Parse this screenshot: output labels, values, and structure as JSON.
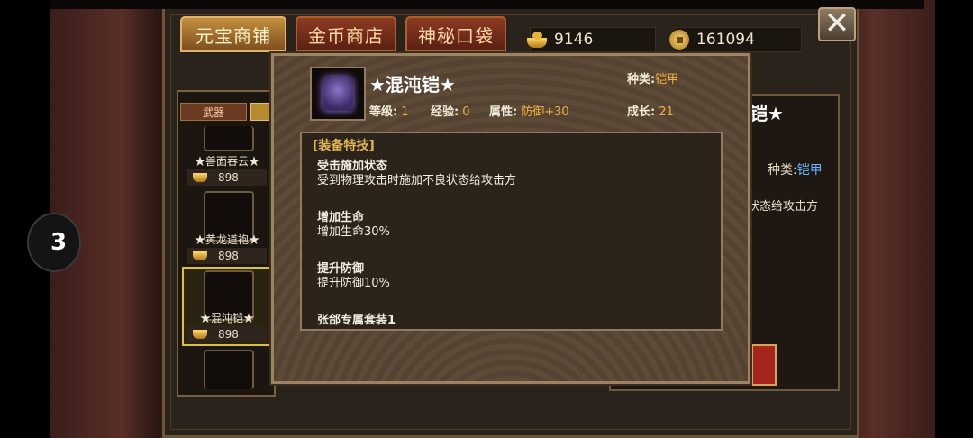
{
  "tabs": [
    {
      "label": "元宝商铺",
      "active": true
    },
    {
      "label": "金币商店",
      "active": false
    },
    {
      "label": "神秘口袋",
      "active": false
    }
  ],
  "currency": {
    "ingot_icon": "gold-ingot-icon",
    "ingot_amount": "9146",
    "coin_icon": "gold-coin-icon",
    "coin_amount": "161094"
  },
  "close_icon": "close-icon",
  "categories": [
    "武器",
    ""
  ],
  "shop_items": [
    {
      "name": "★兽面吞云★",
      "price": "898"
    },
    {
      "name": "★黄龙道袍★",
      "price": "898"
    },
    {
      "name": "★混沌铠★",
      "price": "898",
      "selected": true
    },
    {
      "name": "",
      "price": ""
    }
  ],
  "background_panel": {
    "title_fragment": "铠★",
    "type_label": "种类:",
    "type_value": "铠甲",
    "text_fragment": "状态给攻击方"
  },
  "popup": {
    "item_name": "★混沌铠★",
    "type_label": "种类:",
    "type_value": "铠甲",
    "level_label": "等级:",
    "level_value": "1",
    "exp_label": "经验:",
    "exp_value": "0",
    "attr_label": "属性:",
    "attr_value": "防御+30",
    "growth_label": "成长:",
    "growth_value": "21",
    "skills_header": "[装备特技]",
    "skills": [
      {
        "name": "受击施加状态",
        "desc": "受到物理攻击时施加不良状态给攻击方"
      },
      {
        "name": "增加生命",
        "desc": "增加生命30%"
      },
      {
        "name": "提升防御",
        "desc": "提升防御10%"
      },
      {
        "name": "张郃专属套装1",
        "desc": ""
      }
    ]
  },
  "colors": {
    "accent_gold": "#f1b33b",
    "type_blue": "#5fb6ff",
    "frame": "#9c8462"
  }
}
